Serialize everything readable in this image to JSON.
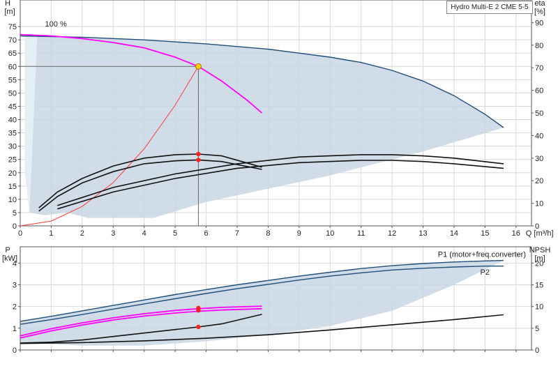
{
  "chart_data": [
    {
      "type": "line",
      "title": "Hydro Multi-E 2 CME 5-5",
      "xlabel": "Q [m³/h]",
      "ylabel_left": [
        "H",
        "[m]"
      ],
      "ylabel_right": [
        "eta",
        "[%]"
      ],
      "xlim": [
        0,
        16.5
      ],
      "ylim_left": [
        0,
        85
      ],
      "ylim_right": [
        0,
        100
      ],
      "x_ticks": [
        "0",
        "1",
        "2",
        "3",
        "4",
        "5",
        "6",
        "7",
        "8",
        "9",
        "10",
        "11",
        "12",
        "13",
        "14",
        "15",
        "16"
      ],
      "y_ticks_left": [
        "0",
        "5",
        "10",
        "15",
        "20",
        "25",
        "30",
        "35",
        "40",
        "45",
        "50",
        "55",
        "60",
        "65",
        "70",
        "75"
      ],
      "y_ticks_right": [
        "0",
        "10",
        "20",
        "30",
        "40",
        "50",
        "60",
        "70",
        "80",
        "90"
      ],
      "annotation": "100 %",
      "duty_point": {
        "x": 5.75,
        "y": 60
      },
      "series": [
        {
          "role": "max-curve",
          "color": "#1f4e79",
          "x": [
            0,
            2,
            4,
            6,
            8,
            9,
            10,
            11,
            12,
            13,
            14,
            15,
            15.6
          ],
          "y": [
            71.5,
            71,
            70,
            68.5,
            66.5,
            65,
            63.5,
            61.5,
            58.5,
            54.5,
            49,
            42,
            37
          ]
        },
        {
          "role": "100%-curve",
          "color": "#ff00ff",
          "x": [
            0,
            1,
            2,
            3,
            4,
            5,
            5.75,
            6.5,
            7.3,
            7.8
          ],
          "y": [
            72,
            71.5,
            70.5,
            69,
            67,
            63.5,
            60,
            54.5,
            47.5,
            42.5
          ]
        },
        {
          "role": "system-curve",
          "color": "#ff3b3b",
          "x": [
            0,
            1,
            2,
            3,
            4,
            5,
            5.75
          ],
          "y": [
            0,
            1.8,
            7.3,
            16.3,
            29,
            45.4,
            60
          ]
        },
        {
          "role": "eta-pump",
          "color": "#111",
          "x": [
            0.6,
            1.2,
            2,
            3,
            4,
            5,
            5.75,
            6.5,
            7.8
          ],
          "y": [
            8,
            15,
            21,
            26.5,
            30,
            31.5,
            31.8,
            31,
            26
          ]
        },
        {
          "role": "eta-total",
          "color": "#111",
          "x": [
            0.6,
            1.2,
            2,
            3,
            4,
            5,
            5.75,
            6.5,
            7.8
          ],
          "y": [
            6.5,
            13,
            19,
            24,
            27.5,
            28.8,
            29.2,
            28.5,
            25
          ]
        },
        {
          "role": "eta-max-1",
          "color": "#111",
          "x": [
            1.2,
            3,
            5,
            7,
            9,
            11,
            12,
            13,
            14,
            15.6
          ],
          "y": [
            9,
            17,
            23,
            27.5,
            30.5,
            31.5,
            31.5,
            31,
            30,
            27.5
          ]
        },
        {
          "role": "eta-max-2",
          "color": "#111",
          "x": [
            1.2,
            3,
            5,
            7,
            9,
            11,
            12,
            13,
            14,
            15.6
          ],
          "y": [
            7.5,
            15,
            21,
            25.5,
            28,
            29,
            29,
            28.5,
            27.5,
            25.5
          ]
        }
      ],
      "markers": [
        {
          "x": 5.75,
          "y": 60,
          "color": "#ffcc00",
          "axis": "left"
        },
        {
          "x": 5.75,
          "y": 31.8,
          "color": "#ff2222",
          "axis": "right"
        },
        {
          "x": 5.75,
          "y": 29.2,
          "color": "#ff2222",
          "axis": "right"
        }
      ],
      "region": {
        "upper": [
          [
            0.15,
            72
          ],
          [
            0.4,
            71.5
          ],
          [
            2,
            71
          ],
          [
            4,
            70
          ],
          [
            6,
            68.5
          ],
          [
            8,
            66.5
          ],
          [
            10,
            63.5
          ],
          [
            11,
            61.5
          ],
          [
            12,
            58.5
          ],
          [
            13,
            54.5
          ],
          [
            14,
            49
          ],
          [
            15,
            42
          ],
          [
            15.6,
            37
          ]
        ],
        "lower": [
          [
            15.6,
            37
          ],
          [
            13,
            28
          ],
          [
            10,
            19
          ],
          [
            8,
            14
          ],
          [
            6,
            9
          ],
          [
            4.3,
            3
          ],
          [
            2.2,
            3
          ],
          [
            1.5,
            5
          ],
          [
            0.8,
            4
          ],
          [
            0.3,
            5
          ],
          [
            0.15,
            20
          ]
        ]
      }
    },
    {
      "type": "line",
      "ylabel_left": [
        "P",
        "[kW]"
      ],
      "ylabel_right": [
        "NPSH",
        "[m]"
      ],
      "xlim": [
        0,
        16.5
      ],
      "ylim_left": [
        0,
        4.75
      ],
      "ylim_right": [
        0,
        23.75
      ],
      "y_ticks_left": [
        "0",
        "1",
        "2",
        "3",
        "4"
      ],
      "y_ticks_right": [
        "0",
        "5",
        "10",
        "15",
        "20"
      ],
      "legend_labels": {
        "p1": "P1 (motor+freq.converter)",
        "p2": "P2"
      },
      "series": [
        {
          "role": "P1-max",
          "color": "#1f4e79",
          "x": [
            0,
            1,
            2,
            3,
            4,
            5,
            6,
            7,
            8,
            9,
            10,
            11,
            12,
            13,
            14,
            15,
            15.6
          ],
          "y": [
            1.32,
            1.55,
            1.8,
            2.05,
            2.3,
            2.55,
            2.78,
            3.0,
            3.2,
            3.4,
            3.58,
            3.75,
            3.88,
            3.98,
            4.05,
            4.1,
            4.12
          ]
        },
        {
          "role": "P2-max",
          "color": "#1f4e79",
          "x": [
            0,
            1,
            2,
            3,
            4,
            5,
            6,
            7,
            8,
            9,
            10,
            11,
            12,
            13,
            14,
            15,
            15.6
          ],
          "y": [
            1.18,
            1.4,
            1.63,
            1.88,
            2.12,
            2.36,
            2.6,
            2.82,
            3.02,
            3.22,
            3.4,
            3.55,
            3.68,
            3.76,
            3.82,
            3.86,
            3.86
          ]
        },
        {
          "role": "P1-100%",
          "color": "#ff00ff",
          "x": [
            0,
            1,
            2,
            3,
            4,
            5,
            5.75,
            6.5,
            7.8
          ],
          "y": [
            0.65,
            0.98,
            1.25,
            1.48,
            1.67,
            1.82,
            1.9,
            1.96,
            2.02
          ]
        },
        {
          "role": "P2-100%",
          "color": "#ff00ff",
          "x": [
            0,
            1,
            2,
            3,
            4,
            5,
            5.75,
            6.5,
            7.8
          ],
          "y": [
            0.55,
            0.88,
            1.15,
            1.38,
            1.56,
            1.7,
            1.78,
            1.84,
            1.9
          ]
        },
        {
          "role": "NPSH-100%",
          "color": "#111",
          "x": [
            0,
            1,
            2,
            3,
            4,
            5,
            5.75,
            6.5,
            7.8
          ],
          "y": [
            1.6,
            1.8,
            2.3,
            3.1,
            3.9,
            4.7,
            5.3,
            6.0,
            8.2
          ]
        },
        {
          "role": "NPSH-max",
          "color": "#111",
          "x": [
            0,
            2,
            4,
            6,
            8,
            10,
            12,
            14,
            15.6
          ],
          "y": [
            1.5,
            1.7,
            2.1,
            2.7,
            3.5,
            4.6,
            5.8,
            7.0,
            8.1
          ]
        }
      ],
      "markers": [
        {
          "x": 5.75,
          "y": 1.93,
          "color": "#ff2222",
          "axis": "left"
        },
        {
          "x": 5.75,
          "y": 1.82,
          "color": "#ff2222",
          "axis": "left"
        },
        {
          "x": 5.75,
          "y": 1.06,
          "color": "#ff2222",
          "axis": "left"
        }
      ],
      "region": {
        "upper": [
          [
            0,
            1.32
          ],
          [
            2,
            1.8
          ],
          [
            4,
            2.3
          ],
          [
            6,
            2.78
          ],
          [
            8,
            3.2
          ],
          [
            10,
            3.58
          ],
          [
            12,
            3.88
          ],
          [
            14,
            4.05
          ],
          [
            15.6,
            4.12
          ]
        ],
        "lower": [
          [
            15.6,
            4.12
          ],
          [
            14,
            3.0
          ],
          [
            12,
            1.8
          ],
          [
            10,
            1.1
          ],
          [
            8,
            0.7
          ],
          [
            6,
            0.4
          ],
          [
            4,
            0.2
          ],
          [
            2,
            0.2
          ],
          [
            0,
            0.35
          ]
        ]
      }
    }
  ]
}
